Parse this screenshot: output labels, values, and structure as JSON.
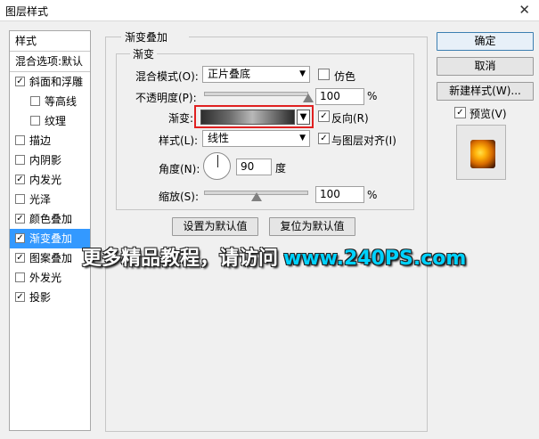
{
  "window": {
    "title": "图层样式",
    "close_icon": "close-icon"
  },
  "sidebar": {
    "header": "样式",
    "blend_options": "混合选项:默认",
    "items": [
      {
        "label": "斜面和浮雕",
        "checked": true,
        "indent": false
      },
      {
        "label": "等高线",
        "checked": false,
        "indent": true
      },
      {
        "label": "纹理",
        "checked": false,
        "indent": true
      },
      {
        "label": "描边",
        "checked": false,
        "indent": false
      },
      {
        "label": "内阴影",
        "checked": false,
        "indent": false
      },
      {
        "label": "内发光",
        "checked": true,
        "indent": false
      },
      {
        "label": "光泽",
        "checked": false,
        "indent": false
      },
      {
        "label": "颜色叠加",
        "checked": true,
        "indent": false
      },
      {
        "label": "渐变叠加",
        "checked": true,
        "indent": false,
        "selected": true
      },
      {
        "label": "图案叠加",
        "checked": true,
        "indent": false
      },
      {
        "label": "外发光",
        "checked": false,
        "indent": false
      },
      {
        "label": "投影",
        "checked": true,
        "indent": false
      }
    ]
  },
  "panel": {
    "section_title": "渐变叠加",
    "group_title": "渐变",
    "blend_mode_label": "混合模式(O):",
    "blend_mode_value": "正片叠底",
    "dither_label": "仿色",
    "dither_checked": false,
    "opacity_label": "不透明度(P):",
    "opacity_value": "100",
    "opacity_unit": "%",
    "opacity_level": 1.0,
    "gradient_label": "渐变:",
    "reverse_label": "反向(R)",
    "reverse_checked": true,
    "style_label": "样式(L):",
    "style_value": "线性",
    "align_label": "与图层对齐(I)",
    "align_checked": true,
    "angle_label": "角度(N):",
    "angle_value": "90",
    "angle_unit": "度",
    "scale_label": "缩放(S):",
    "scale_value": "100",
    "scale_unit": "%",
    "scale_level": 0.5,
    "set_default_button": "设置为默认值",
    "reset_default_button": "复位为默认值"
  },
  "right": {
    "ok_button": "确定",
    "cancel_button": "取消",
    "new_style_button": "新建样式(W)...",
    "preview_label": "预览(V)",
    "preview_checked": true
  },
  "watermark": {
    "text": "更多精品教程，请访问",
    "url": "www.240PS.com"
  },
  "colors": {
    "selection": "#3399ff",
    "highlight_border": "#e02020",
    "watermark_url": "#00d2ff"
  }
}
